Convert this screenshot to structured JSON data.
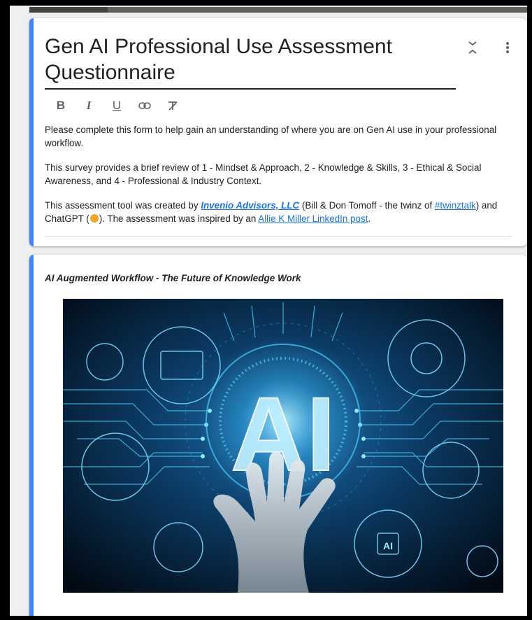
{
  "form": {
    "title": "Gen AI Professional Use Assessment Questionnaire",
    "toolbar": {
      "bold": "B",
      "italic": "I",
      "underline": "U"
    },
    "description": {
      "p1": "Please complete this form to help gain an understanding of where you are on Gen AI use in your professional workflow.",
      "p2": "This survey provides a brief review of 1 -  Mindset & Approach, 2 - Knowledge & Skills,  3 - Ethical & Social Awareness, and 4 - Professional & Industry Context.",
      "p3_a": "This assessment tool was created by ",
      "p3_link1": "Invenio Advisors, LLC",
      "p3_b": " (Bill & Don Tomoff - the twinz of ",
      "p3_link2": "#twinztalk",
      "p3_c": ") and ChatGPT (",
      "p3_d": "). The assessment was inspired by an ",
      "p3_link3": "Allie K Miller LinkedIn post",
      "p3_e": "."
    }
  },
  "section": {
    "title": "AI Augmented Workflow - The Future of Knowledge Work",
    "image_text": "AI",
    "image_badge": "AI"
  },
  "colors": {
    "accent": "#4285f4",
    "link": "#1a73e8",
    "image_bg": "#061826",
    "glow": "#39c6ff"
  },
  "icons": [
    "collapse-icon",
    "more-vert-icon",
    "bold-icon",
    "italic-icon",
    "underline-icon",
    "link-icon",
    "clear-format-icon"
  ]
}
